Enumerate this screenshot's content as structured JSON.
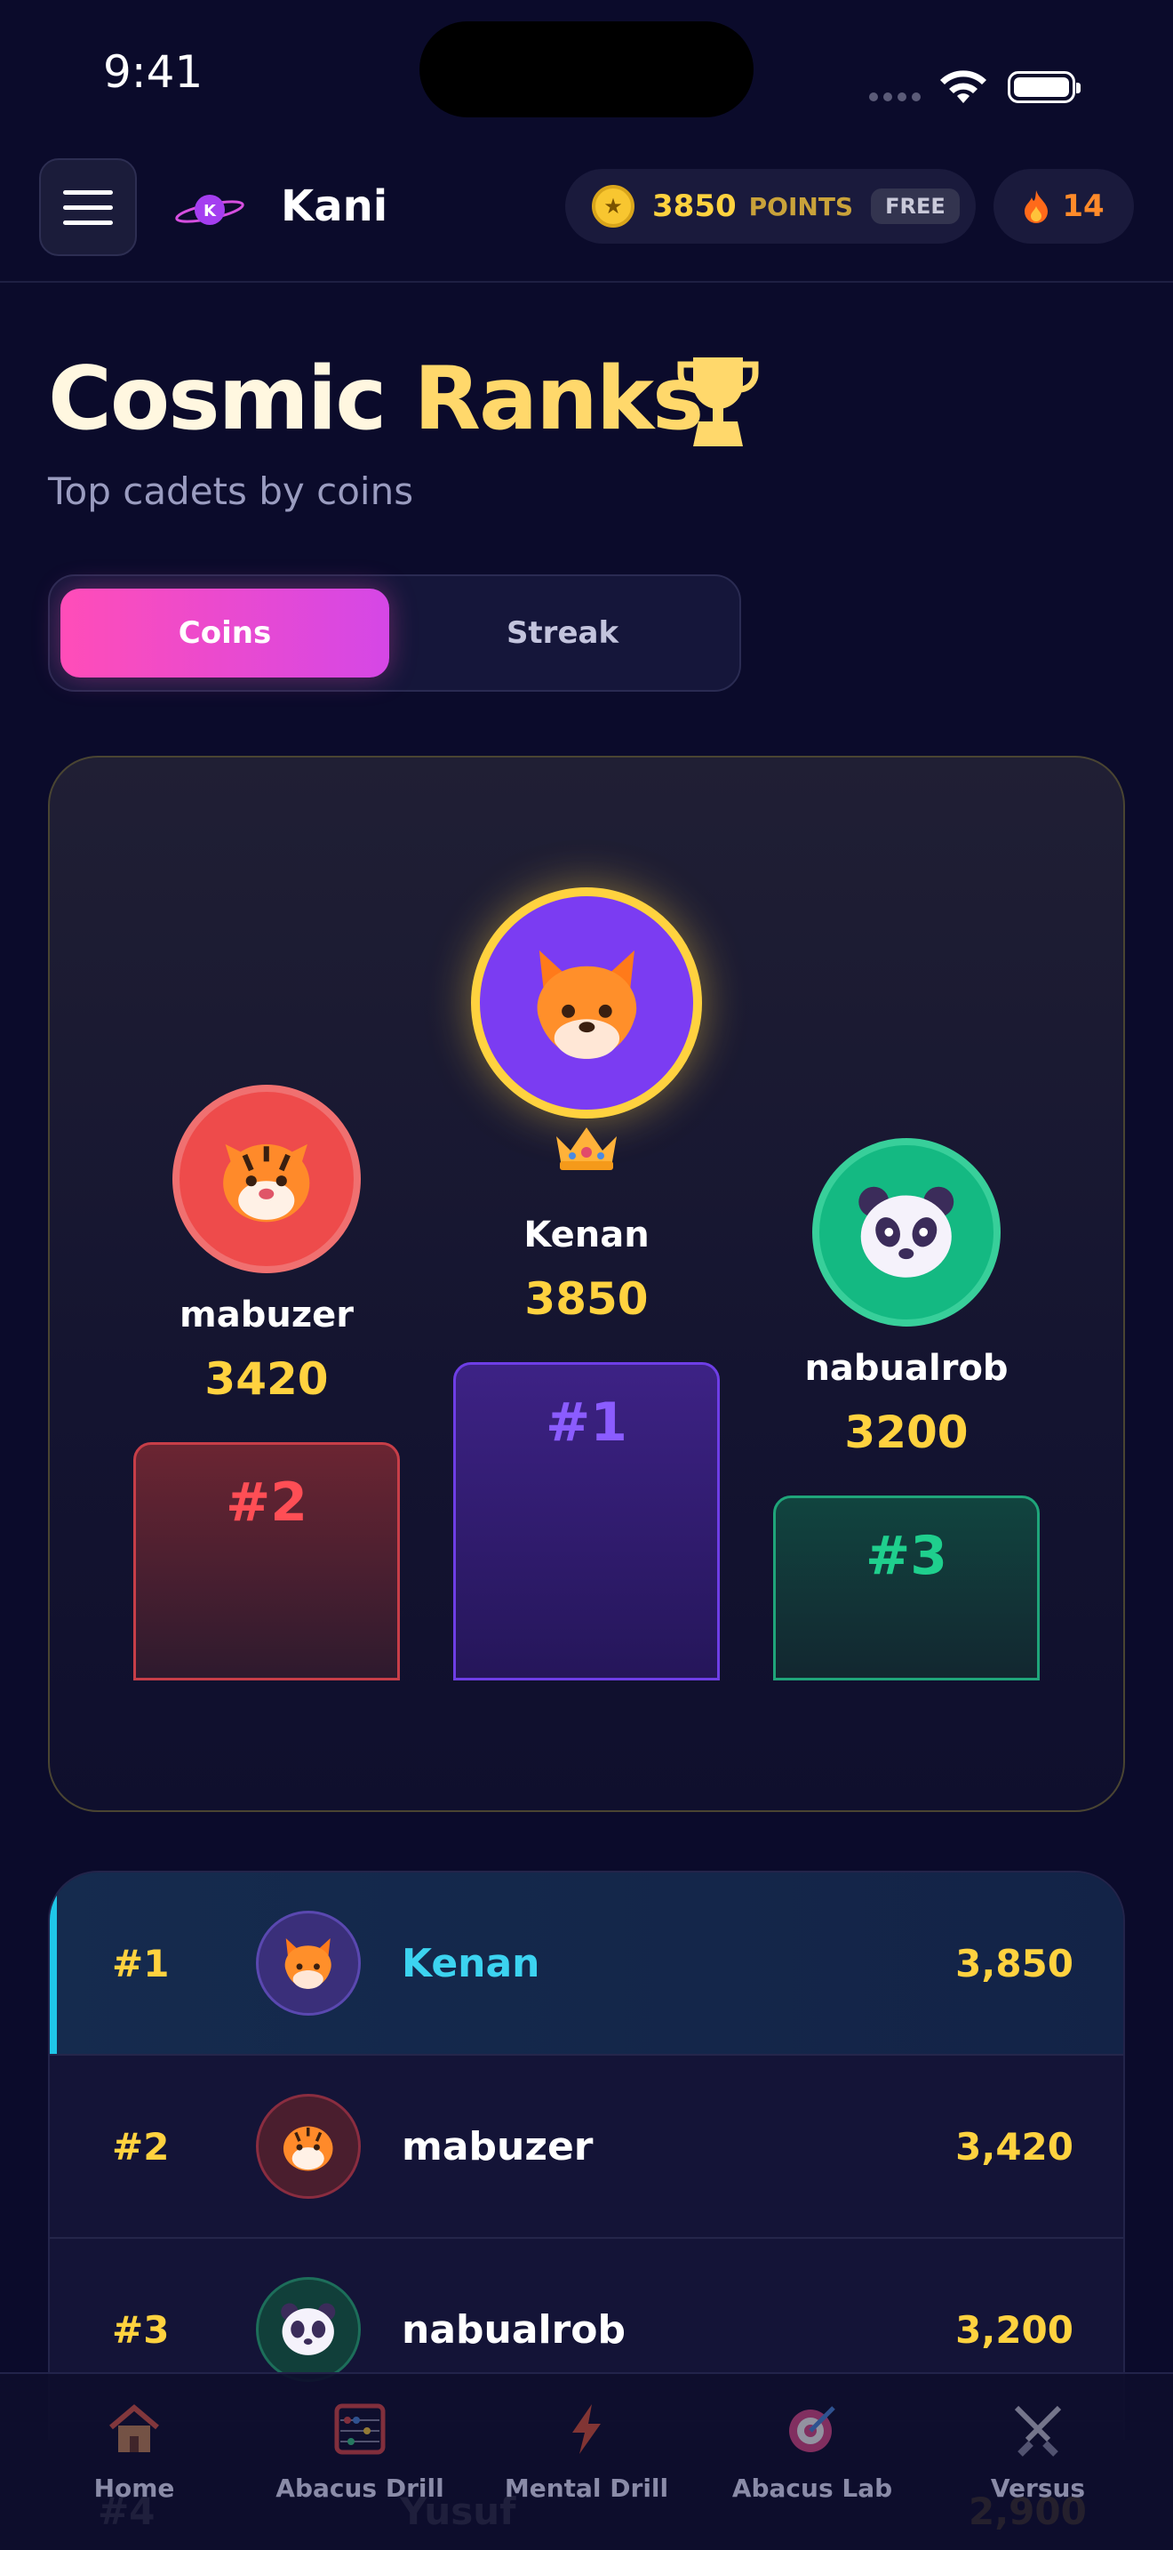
{
  "status": {
    "time": "9:41"
  },
  "header": {
    "brand": "Kani",
    "planet_letter": "K",
    "points_value": "3850",
    "points_label": "POINTS",
    "plan_badge": "FREE",
    "streak_value": "14"
  },
  "page": {
    "title_part1": "Cosmic ",
    "title_part2": "Ranks",
    "subtitle": "Top cadets by coins"
  },
  "tabs": {
    "active": "Coins",
    "inactive": "Streak"
  },
  "podium": {
    "first": {
      "name": "Kenan",
      "score": "3850",
      "rank": "#1",
      "avatar": "fox-icon"
    },
    "second": {
      "name": "mabuzer",
      "score": "3420",
      "rank": "#2",
      "avatar": "tiger-icon"
    },
    "third": {
      "name": "nabualrob",
      "score": "3200",
      "rank": "#3",
      "avatar": "panda-icon"
    }
  },
  "leaderboard": [
    {
      "rank": "#1",
      "name": "Kenan",
      "score": "3,850",
      "avatar": "fox-icon"
    },
    {
      "rank": "#2",
      "name": "mabuzer",
      "score": "3,420",
      "avatar": "tiger-icon"
    },
    {
      "rank": "#3",
      "name": "nabualrob",
      "score": "3,200",
      "avatar": "panda-icon"
    }
  ],
  "ghost_row": {
    "rank": "#4",
    "name": "Yusuf",
    "score": "2,900"
  },
  "nav": [
    {
      "label": "Home",
      "icon": "home-icon"
    },
    {
      "label": "Abacus Drill",
      "icon": "abacus-icon"
    },
    {
      "label": "Mental Drill",
      "icon": "lightning-icon"
    },
    {
      "label": "Abacus Lab",
      "icon": "target-icon"
    },
    {
      "label": "Versus",
      "icon": "swords-icon"
    }
  ],
  "colors": {
    "background": "#0b0b2b",
    "accent_gold": "#ffd23f",
    "accent_pink": "#ff4db8",
    "accent_cyan": "#1fc7e8"
  }
}
